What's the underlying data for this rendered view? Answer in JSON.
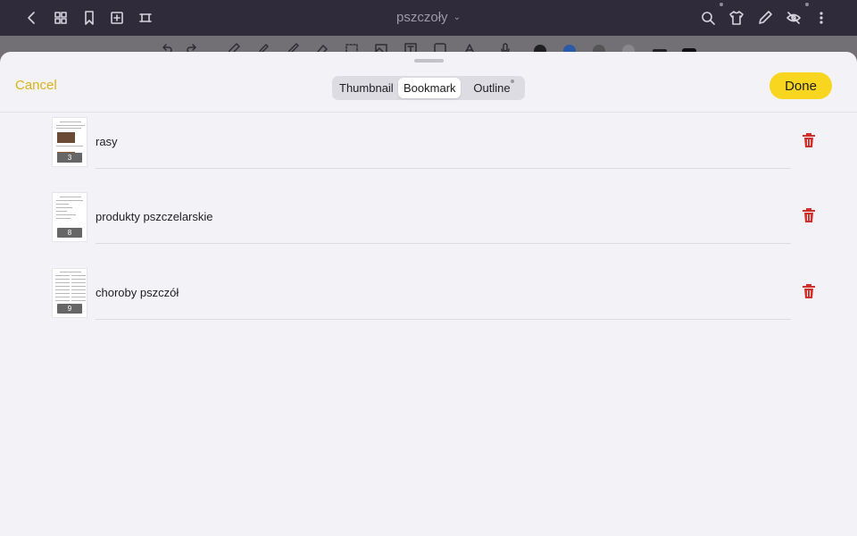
{
  "appbar": {
    "title": "pszczoły"
  },
  "sheet": {
    "cancel_label": "Cancel",
    "done_label": "Done",
    "tabs": [
      {
        "label": "Thumbnail",
        "active": false
      },
      {
        "label": "Bookmark",
        "active": true
      },
      {
        "label": "Outline",
        "active": false
      }
    ]
  },
  "bookmarks": [
    {
      "title": "rasy",
      "page": "3"
    },
    {
      "title": "produkty pszczelarskie",
      "page": "8"
    },
    {
      "title": "choroby pszczół",
      "page": "9"
    }
  ],
  "colors": {
    "accent": "#f8d61f",
    "cancel": "#d9b21b",
    "delete": "#d1302c"
  }
}
